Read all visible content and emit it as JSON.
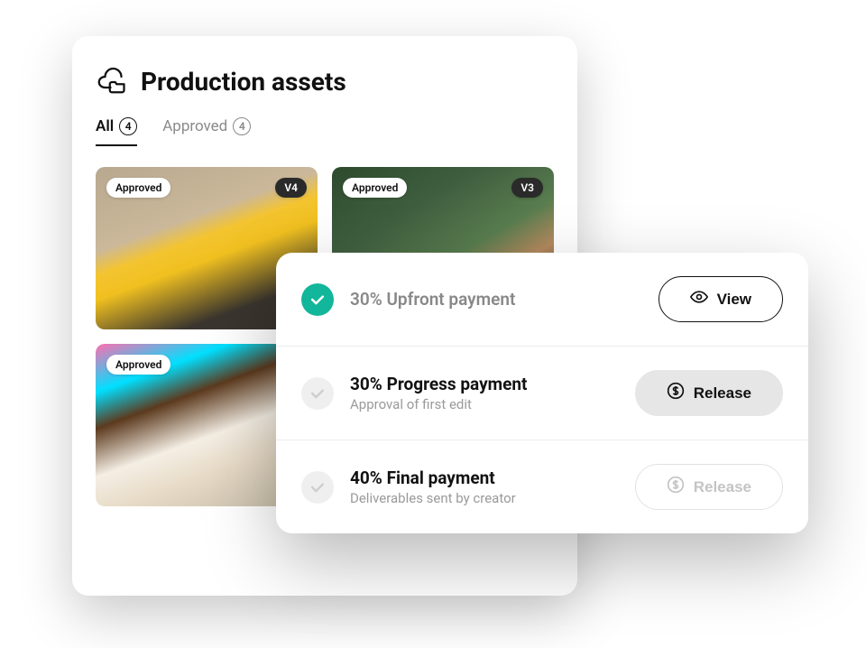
{
  "header": {
    "title": "Production assets"
  },
  "tabs": [
    {
      "label": "All",
      "count": "4",
      "active": true
    },
    {
      "label": "Approved",
      "count": "4",
      "active": false
    }
  ],
  "assets": [
    {
      "status": "Approved",
      "version": "V4"
    },
    {
      "status": "Approved",
      "version": "V3"
    },
    {
      "status": "Approved",
      "version": ""
    },
    {
      "status": "",
      "version": ""
    }
  ],
  "payments": [
    {
      "title": "30% Upfront payment",
      "subtitle": "",
      "completed": true,
      "action": {
        "label": "View",
        "kind": "view"
      }
    },
    {
      "title": "30% Progress payment",
      "subtitle": "Approval of first edit",
      "completed": false,
      "action": {
        "label": "Release",
        "kind": "release-active"
      }
    },
    {
      "title": "40% Final payment",
      "subtitle": "Deliverables sent by creator",
      "completed": false,
      "action": {
        "label": "Release",
        "kind": "release-disabled"
      }
    }
  ]
}
